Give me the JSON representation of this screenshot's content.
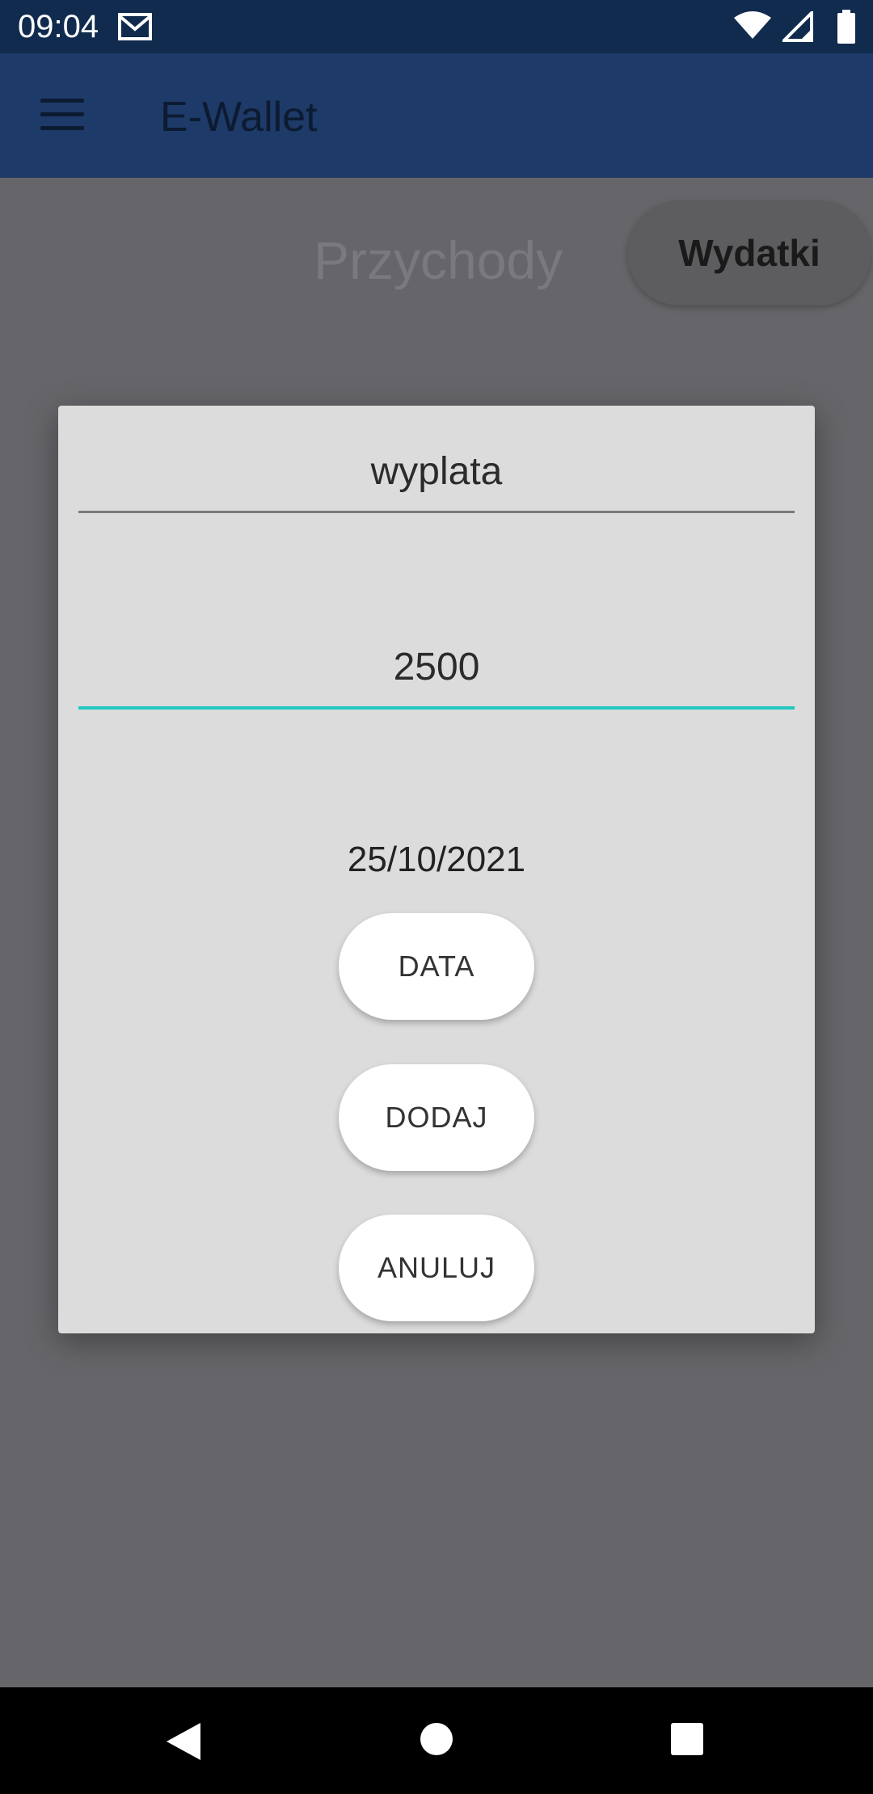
{
  "status_bar": {
    "time": "09:04",
    "icons": [
      "gmail-icon",
      "wifi-icon",
      "signal-icon",
      "battery-icon"
    ]
  },
  "app_bar": {
    "title": "E-Wallet",
    "menu_icon": "menu-icon"
  },
  "tabs": {
    "income_label": "Przychody",
    "expenses_label": "Wydatki"
  },
  "dialog": {
    "name_value": "wyplata",
    "amount_value": "2500",
    "date_value": "25/10/2021",
    "date_button": "DATA",
    "add_button": "DODAJ",
    "cancel_button": "ANULUJ"
  },
  "nav_bar": {
    "icons": [
      "back-icon",
      "home-icon",
      "recents-icon"
    ]
  },
  "colors": {
    "status_bar": "#112b4f",
    "app_bar": "#1e3a68",
    "accent_underline": "#22c7c1",
    "dialog_bg": "#dcdcdc"
  }
}
